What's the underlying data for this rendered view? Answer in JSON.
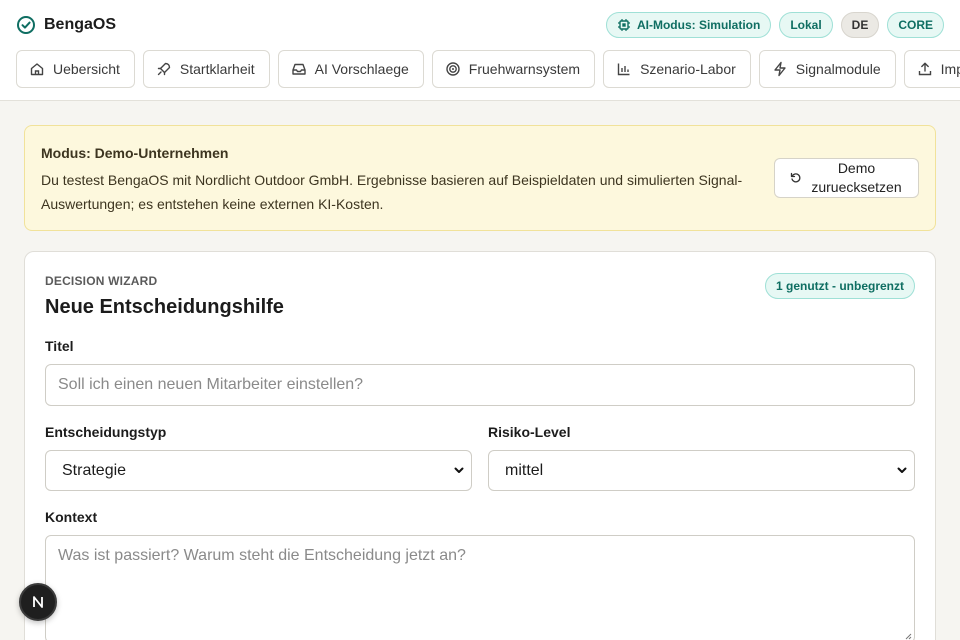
{
  "app": {
    "name": "BengaOS"
  },
  "header_badges": {
    "ai_mode": "AI-Modus: Simulation",
    "local": "Lokal",
    "language": "DE",
    "core": "CORE"
  },
  "nav": {
    "tabs": [
      {
        "label": "Uebersicht",
        "icon": "home-icon"
      },
      {
        "label": "Startklarheit",
        "icon": "rocket-icon"
      },
      {
        "label": "AI Vorschlaege",
        "icon": "inbox-icon"
      },
      {
        "label": "Fruehwarnsystem",
        "icon": "radar-icon"
      },
      {
        "label": "Szenario-Labor",
        "icon": "bar-chart-icon"
      },
      {
        "label": "Signalmodule",
        "icon": "zap-icon"
      },
      {
        "label": "Impo",
        "icon": "upload-icon"
      }
    ]
  },
  "demo_notice": {
    "title": "Modus: Demo-Unternehmen",
    "text": "Du testest BengaOS mit Nordlicht Outdoor GmbH. Ergebnisse basieren auf Beispieldaten und simulierten Signal-Auswertungen; es entstehen keine externen KI-Kosten.",
    "reset_label": "Demo zuruecksetzen"
  },
  "wizard": {
    "eyebrow": "DECISION WIZARD",
    "title": "Neue Entscheidungshilfe",
    "usage": "1 genutzt - unbegrenzt",
    "title_label": "Titel",
    "title_placeholder": "Soll ich einen neuen Mitarbeiter einstellen?",
    "type_label": "Entscheidungstyp",
    "type_value": "Strategie",
    "risk_label": "Risiko-Level",
    "risk_value": "mittel",
    "context_label": "Kontext",
    "context_placeholder": "Was ist passiert? Warum steht die Entscheidung jetzt an?"
  },
  "floating": {
    "dev_badge": "N"
  },
  "colors": {
    "accent": "#0f6e62",
    "accent_bg": "#e7f8f4",
    "notice_bg": "#fdf8dd",
    "page_bg": "#f6f5f1"
  }
}
